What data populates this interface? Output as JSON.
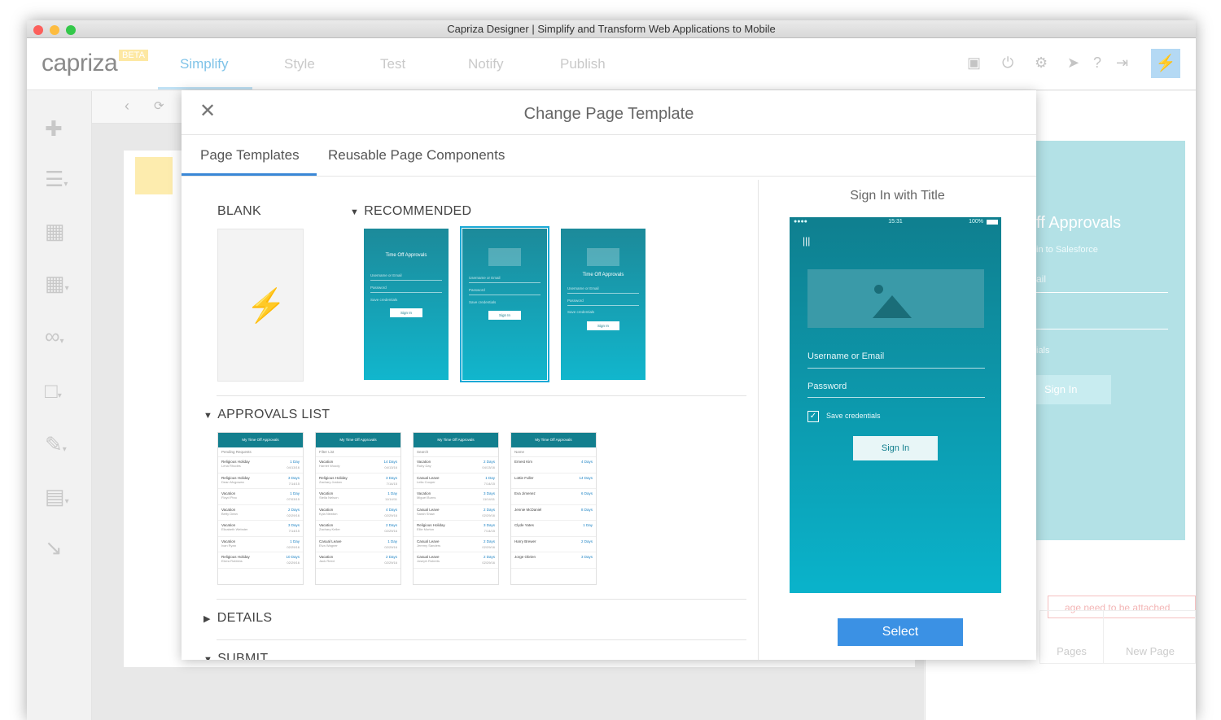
{
  "window": {
    "title": "Capriza Designer | Simplify and Transform Web Applications to Mobile"
  },
  "brand": {
    "logo": "capriza",
    "badge": "BETA"
  },
  "nav": {
    "tabs": [
      "Simplify",
      "Style",
      "Test",
      "Notify",
      "Publish"
    ],
    "active": "Simplify"
  },
  "toolbar_icons": [
    "save-icon",
    "power-icon",
    "gear-icon",
    "send-icon",
    "help-icon",
    "logout-icon",
    "bolt-icon"
  ],
  "sidebar_icons": [
    "add-icon",
    "text-icon",
    "image-icon",
    "grid-icon",
    "link-icon",
    "panel-icon",
    "settings-edit-icon",
    "document-icon",
    "import-icon"
  ],
  "background_preview": {
    "title": "ff Approvals",
    "subtitle": "in to Salesforce",
    "field1": "ail",
    "field2": "ials",
    "button": "Sign In",
    "warning": "age need to be attached",
    "pages_label": "Pages",
    "new_page_label": "New Page"
  },
  "modal": {
    "title": "Change Page Template",
    "tabs": [
      "Page Templates",
      "Reusable Page Components"
    ],
    "sections": {
      "blank": "BLANK",
      "recommended": "RECOMMENDED",
      "approvals": "APPROVALS LIST",
      "details": "DETAILS",
      "submit": "SUBMIT"
    },
    "mini": {
      "title": "Time Off Approvals",
      "username": "Username or Email",
      "password": "Password",
      "save": "Save credentials",
      "signin": "Sign In"
    },
    "lists": [
      {
        "title": "My Time Off Approvals",
        "sub": "Pending Requests",
        "rows": [
          [
            "Religious Holiday",
            "Lena Rhodes",
            "1 Day",
            "04/13/16"
          ],
          [
            "Religious Holiday",
            "Dean Mcgowan",
            "3 Days",
            "7/14/15"
          ],
          [
            "Vacation",
            "Floyd Pino",
            "1 Day",
            "07/03/15"
          ],
          [
            "Vacation",
            "Betty Dean",
            "2 Days",
            "02/29/16"
          ],
          [
            "Vacation",
            "Elizabeth Webster",
            "3 Days",
            "7/14/15"
          ],
          [
            "Vacation",
            "Ivan Ryan",
            "1 Day",
            "02/29/16"
          ],
          [
            "Religious Holiday",
            "Elvira Robbins",
            "10 Days",
            "02/29/16"
          ]
        ]
      },
      {
        "title": "My Time Off Approvals",
        "sub": "Filter List",
        "rows": [
          [
            "Vacation",
            "Harriet Woody",
            "14 Days",
            "04/13/16"
          ],
          [
            "Religious Holiday",
            "Zachary Jordan",
            "3 Days",
            "7/14/15"
          ],
          [
            "Vacation",
            "Stella Nelson",
            "1 Day",
            "11/14/11"
          ],
          [
            "Vacation",
            "Kyla Newton",
            "4 Days",
            "02/29/16"
          ],
          [
            "Vacation",
            "Zachary Keller",
            "2 Days",
            "02/29/16"
          ],
          [
            "Casual Leave",
            "Elva Wagner",
            "1 Day",
            "02/29/16"
          ],
          [
            "Vacation",
            "Jack Reed",
            "2 Days",
            "02/29/16"
          ]
        ]
      },
      {
        "title": "My Time Off Approvals",
        "sub": "Search",
        "rows": [
          [
            "Vacation",
            "Ruby Day",
            "2 Days",
            "04/13/16"
          ],
          [
            "Casual Leave",
            "Leila Cooper",
            "1 Day",
            "7/14/15"
          ],
          [
            "Vacation",
            "Miguel Burns",
            "3 Days",
            "11/14/11"
          ],
          [
            "Casual Leave",
            "Sarah Shaw",
            "2 Days",
            "02/29/16"
          ],
          [
            "Religious Holiday",
            "Ellie Morton",
            "3 Days",
            "7/14/15"
          ],
          [
            "Casual Leave",
            "Jeremy Sanders",
            "2 Days",
            "02/29/16"
          ],
          [
            "Casual Leave",
            "Joseph Roberts",
            "2 Days",
            "02/29/16"
          ]
        ]
      },
      {
        "title": "My Time Off Approvals",
        "sub": "Name",
        "rows": [
          [
            "Ernest Kim",
            "",
            "4 Days",
            ""
          ],
          [
            "Lottie Fuller",
            "",
            "14 Days",
            ""
          ],
          [
            "Eva Jimenez",
            "",
            "6 Days",
            ""
          ],
          [
            "Jennie McDaniel",
            "",
            "8 Days",
            ""
          ],
          [
            "Clyde Yates",
            "",
            "1 Day",
            ""
          ],
          [
            "Harry Brewer",
            "",
            "2 Days",
            ""
          ],
          [
            "Jorge Obrien",
            "",
            "3 Days",
            ""
          ]
        ]
      }
    ],
    "preview": {
      "title": "Sign In with Title",
      "time": "15:31",
      "battery": "100%",
      "username": "Username or Email",
      "password": "Password",
      "save": "Save credentials",
      "signin": "Sign In"
    },
    "select_label": "Select"
  }
}
